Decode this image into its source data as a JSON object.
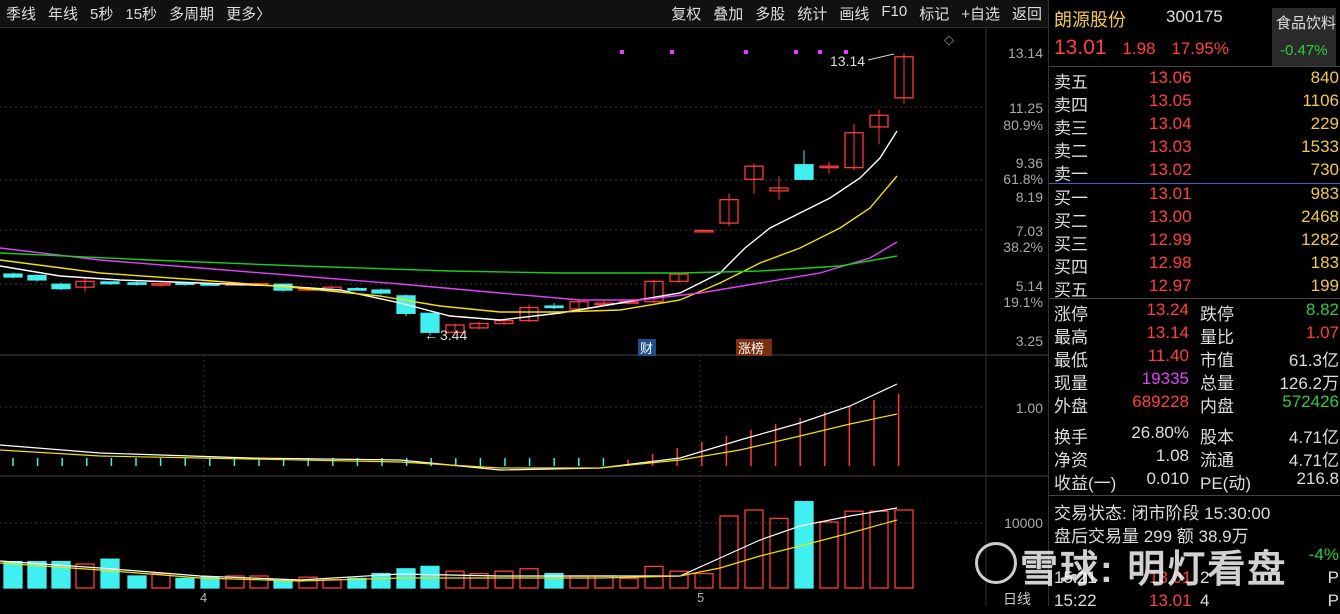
{
  "toolbar": {
    "periods": [
      "季线",
      "年线",
      "5秒",
      "15秒",
      "多周期",
      "更多〉"
    ],
    "actions": [
      "复权",
      "叠加",
      "多股",
      "统计",
      "画线",
      "F10",
      "标记",
      "+自选",
      "返回"
    ]
  },
  "stock": {
    "name": "朗源股份",
    "code": "300175",
    "sector": "食品饮料",
    "sector_change": "-0.47%",
    "price": "13.01",
    "change": "1.98",
    "change_pct": "17.95%"
  },
  "order_book": {
    "asks": [
      {
        "label": "卖五",
        "price": "13.06",
        "vol": "840"
      },
      {
        "label": "卖四",
        "price": "13.05",
        "vol": "1106"
      },
      {
        "label": "卖三",
        "price": "13.04",
        "vol": "229"
      },
      {
        "label": "卖二",
        "price": "13.03",
        "vol": "1533"
      },
      {
        "label": "卖一",
        "price": "13.02",
        "vol": "730"
      }
    ],
    "bids": [
      {
        "label": "买一",
        "price": "13.01",
        "vol": "983"
      },
      {
        "label": "买二",
        "price": "13.00",
        "vol": "2468"
      },
      {
        "label": "买三",
        "price": "12.99",
        "vol": "1282"
      },
      {
        "label": "买四",
        "price": "12.98",
        "vol": "183"
      },
      {
        "label": "买五",
        "price": "12.97",
        "vol": "199"
      }
    ]
  },
  "stats": [
    [
      "涨停",
      "13.24",
      "跌停",
      "8.82"
    ],
    [
      "最高",
      "13.14",
      "量比",
      "1.07"
    ],
    [
      "最低",
      "11.40",
      "市值",
      "61.3亿"
    ],
    [
      "现量",
      "19335",
      "总量",
      "126.2万"
    ],
    [
      "外盘",
      "689228",
      "内盘",
      "572426"
    ],
    [
      "换手",
      "26.80%",
      "股本",
      "4.71亿"
    ],
    [
      "净资",
      "1.08",
      "流通",
      "4.71亿"
    ],
    [
      "收益(一)",
      "0.010",
      "PE(动)",
      "216.8"
    ]
  ],
  "after_hours": {
    "status": "交易状态: 闭市阶段 15:30:00",
    "volume": "盘后交易量 299 额 38.9万",
    "partial": "-4%"
  },
  "ticks": [
    {
      "time": "15:21",
      "price": "13.01",
      "vol": "2",
      "side": "P"
    },
    {
      "time": "15:22",
      "price": "13.01",
      "vol": "4",
      "side": "P"
    }
  ],
  "chart": {
    "price_axis": [
      "13.14",
      "11.25",
      "9.36",
      "8.19",
      "7.03",
      "5.14",
      "3.25"
    ],
    "pct_axis": [
      "80.9%",
      "61.8%",
      "38.2%",
      "19.1%"
    ],
    "high_label": "13.14",
    "low_label": "3.44",
    "tag_cai": "财",
    "tag_zhangbang": "涨榜",
    "indicator_axis": "1.00",
    "volume_axis": "10000",
    "x_labels": [
      "4",
      "5"
    ],
    "period_label": "日线",
    "colors": {
      "up": "#ff3b3b",
      "down": "#40f0f0",
      "ma5": "#ffffff",
      "ma10": "#f5e000",
      "ma20": "#e040fb",
      "ma30": "#18d018"
    }
  },
  "watermark": "雪球: 明灯看盘"
}
